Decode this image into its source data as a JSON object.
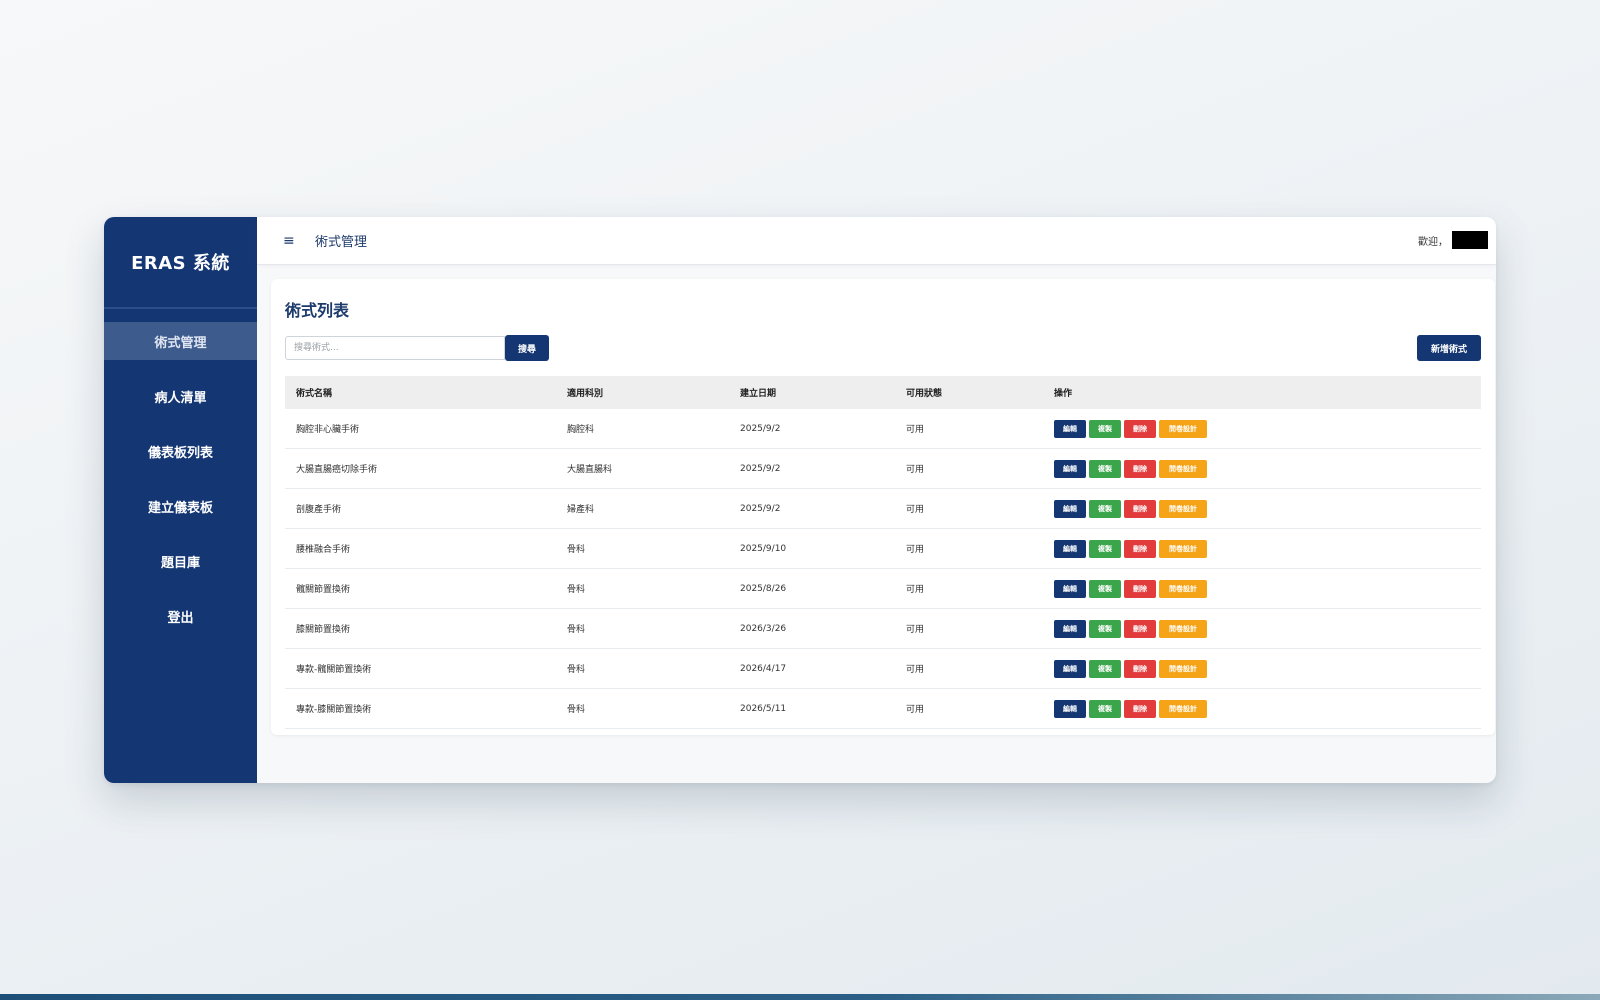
{
  "sidebar": {
    "brand": "ERAS 系統",
    "items": [
      {
        "label": "術式管理",
        "active": true
      },
      {
        "label": "病人清單",
        "active": false
      },
      {
        "label": "儀表板列表",
        "active": false
      },
      {
        "label": "建立儀表板",
        "active": false
      },
      {
        "label": "題目庫",
        "active": false
      },
      {
        "label": "登出",
        "active": false
      }
    ]
  },
  "header": {
    "menu_icon": "≡",
    "title": "術式管理",
    "welcome": "歡迎，"
  },
  "main": {
    "card_title": "術式列表",
    "search_placeholder": "搜尋術式...",
    "search_label": "搜尋",
    "add_label": "新增術式",
    "columns": [
      "術式名稱",
      "適用科別",
      "建立日期",
      "可用狀態",
      "操作"
    ],
    "action_labels": {
      "edit": "編輯",
      "copy": "複製",
      "delete": "刪除",
      "survey": "問卷設計"
    },
    "rows": [
      {
        "name": "胸腔非心臟手術",
        "dept": "胸腔科",
        "date": "2025/9/2",
        "status": "可用"
      },
      {
        "name": "大腸直腸癌切除手術",
        "dept": "大腸直腸科",
        "date": "2025/9/2",
        "status": "可用"
      },
      {
        "name": "剖腹產手術",
        "dept": "婦產科",
        "date": "2025/9/2",
        "status": "可用"
      },
      {
        "name": "腰椎融合手術",
        "dept": "骨科",
        "date": "2025/9/10",
        "status": "可用"
      },
      {
        "name": "髖關節置換術",
        "dept": "骨科",
        "date": "2025/8/26",
        "status": "可用"
      },
      {
        "name": "膝關節置換術",
        "dept": "骨科",
        "date": "2026/3/26",
        "status": "可用"
      },
      {
        "name": "專款-髖關節置換術",
        "dept": "骨科",
        "date": "2026/4/17",
        "status": "可用"
      },
      {
        "name": "專款-膝關節置換術",
        "dept": "骨科",
        "date": "2026/5/11",
        "status": "可用"
      }
    ]
  }
}
